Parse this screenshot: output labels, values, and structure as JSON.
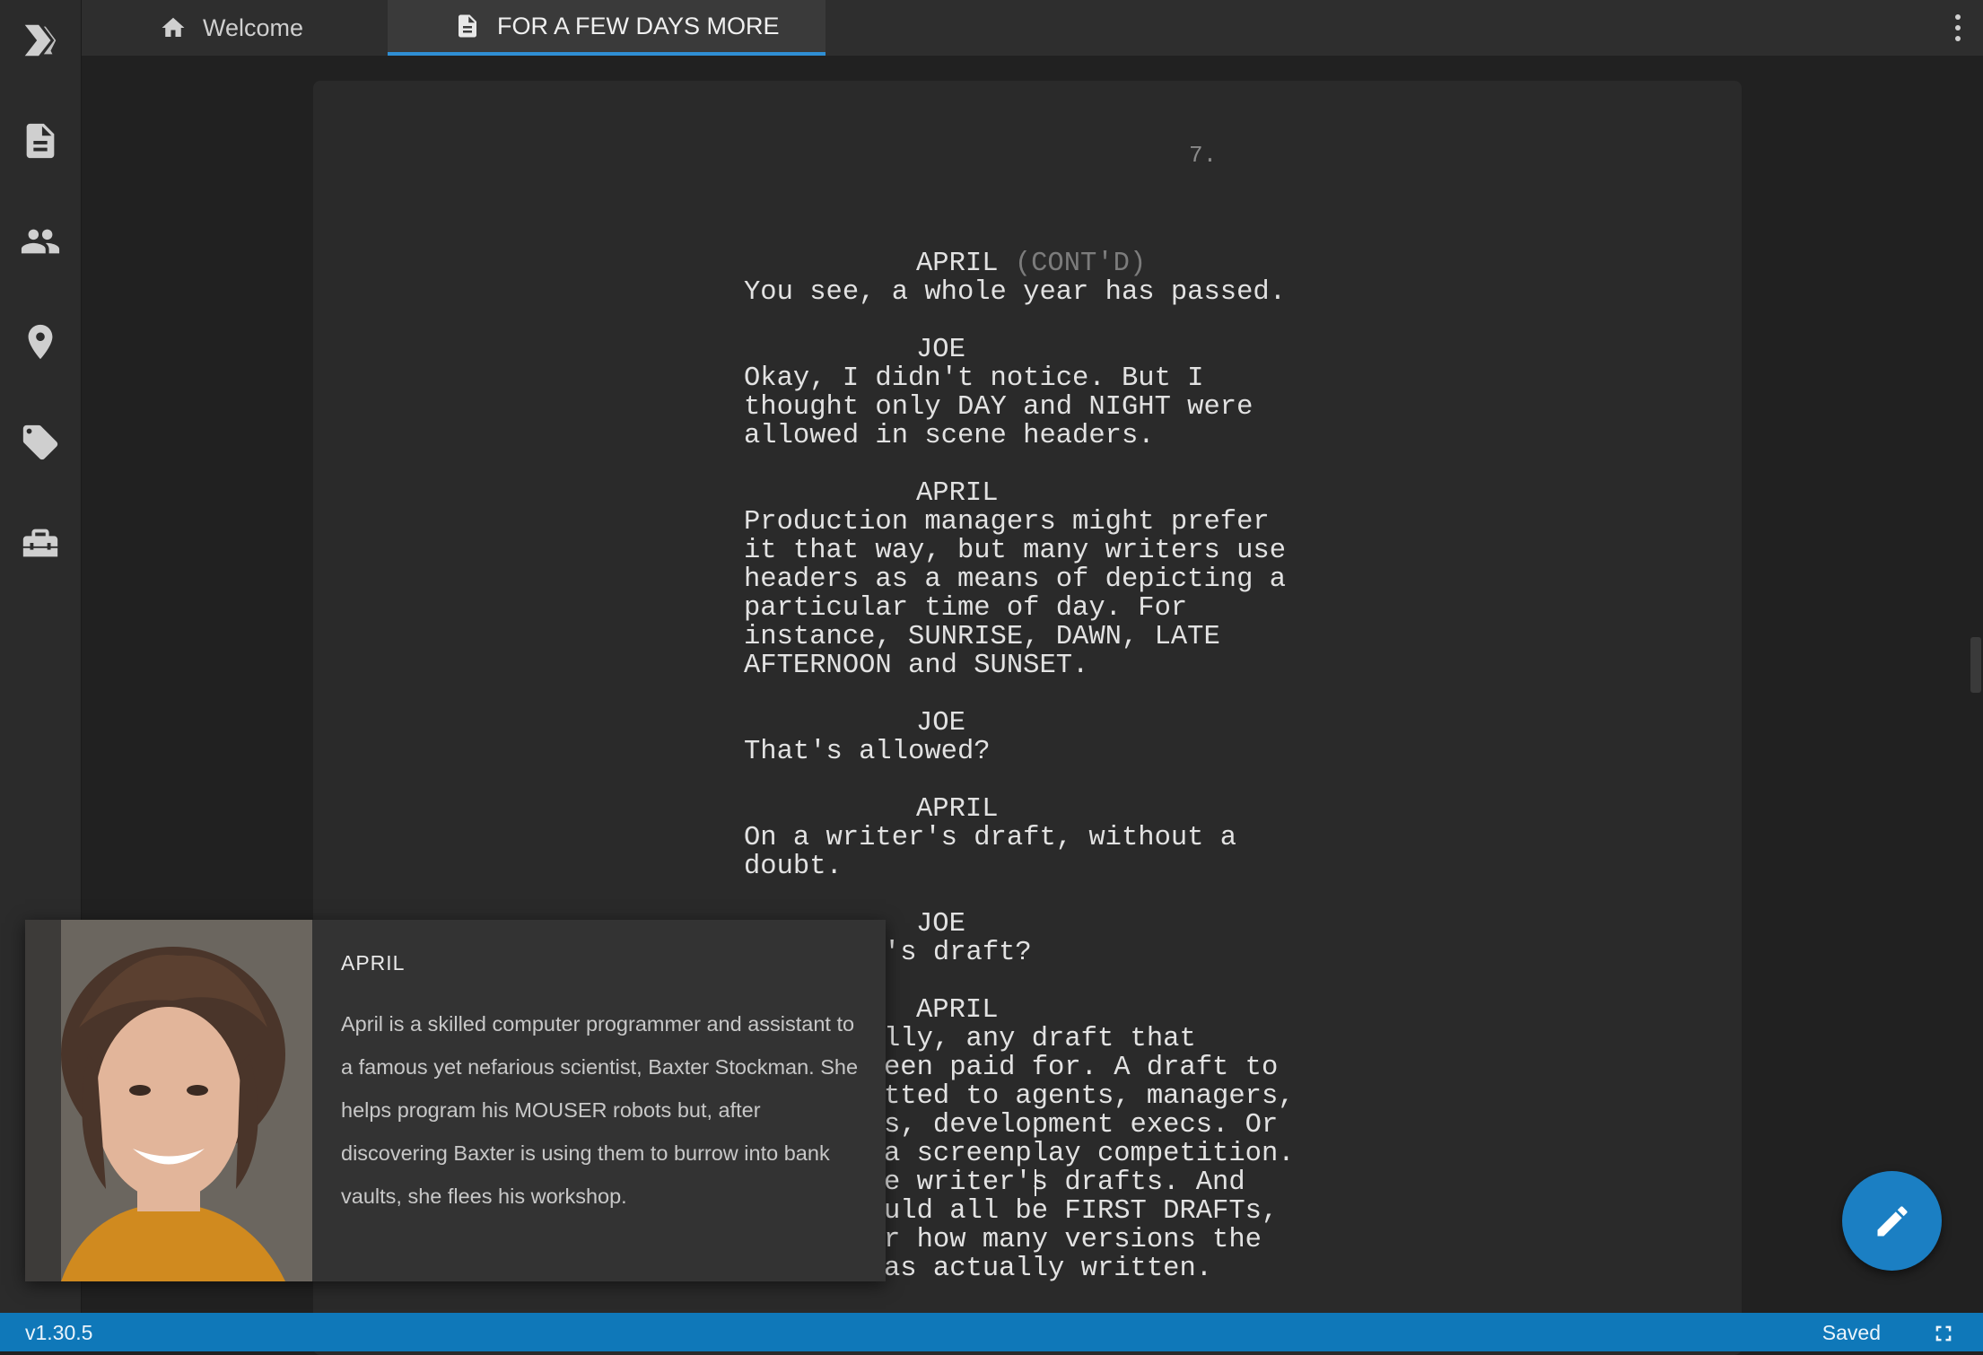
{
  "app": {
    "version": "v1.30.5",
    "status": "Saved"
  },
  "sidebar": {
    "items": [
      {
        "icon": "logo-icon"
      },
      {
        "icon": "document-icon"
      },
      {
        "icon": "people-icon"
      },
      {
        "icon": "location-pin-icon"
      },
      {
        "icon": "tag-icon"
      },
      {
        "icon": "toolbox-icon"
      }
    ]
  },
  "tabs": [
    {
      "label": "Welcome",
      "icon": "home-icon"
    },
    {
      "label": "FOR A FEW DAYS MORE",
      "icon": "document-icon",
      "active": true
    }
  ],
  "script": {
    "page_number": "7.",
    "blocks": [
      {
        "cue": "APRIL",
        "extension": "(CONT'D)",
        "lines": [
          "You see, a whole year has passed."
        ]
      },
      {
        "cue": "JOE",
        "lines": [
          "Okay, I didn't notice. But I",
          "thought only DAY and NIGHT were",
          "allowed in scene headers."
        ]
      },
      {
        "cue": "APRIL",
        "lines": [
          "Production managers might prefer",
          "it that way, but many writers use",
          "headers as a means of depicting a",
          "particular time of day. For",
          "instance, SUNRISE, DAWN, LATE",
          "AFTERNOON and SUNSET."
        ]
      },
      {
        "cue": "JOE",
        "lines": [
          "That's allowed?"
        ]
      },
      {
        "cue": "APRIL",
        "lines": [
          "On a writer's draft, without a",
          "doubt."
        ]
      },
      {
        "cue": "JOE",
        "lines": [
          "'s draft?"
        ]
      },
      {
        "cue": "APRIL",
        "lines": [
          "lly, any draft that",
          "een paid for. A draft to",
          "tted to agents, managers,",
          "s, development execs. Or",
          "a screenplay competition.",
          "e writer's drafts. And",
          "uld all be FIRST DRAFTs,",
          "r how many versions the",
          "as actually written."
        ]
      }
    ]
  },
  "character_card": {
    "name": "APRIL",
    "description": "April is a skilled computer programmer and assistant to a famous yet nefarious scientist, Baxter Stockman. She helps program his MOUSER robots but, after discovering Baxter is using them to burrow into bank vaults, she flees his workshop."
  },
  "colors": {
    "accent": "#1b7fc3",
    "statusbar": "#0f78b9",
    "tab_underline": "#2f8fd4"
  }
}
